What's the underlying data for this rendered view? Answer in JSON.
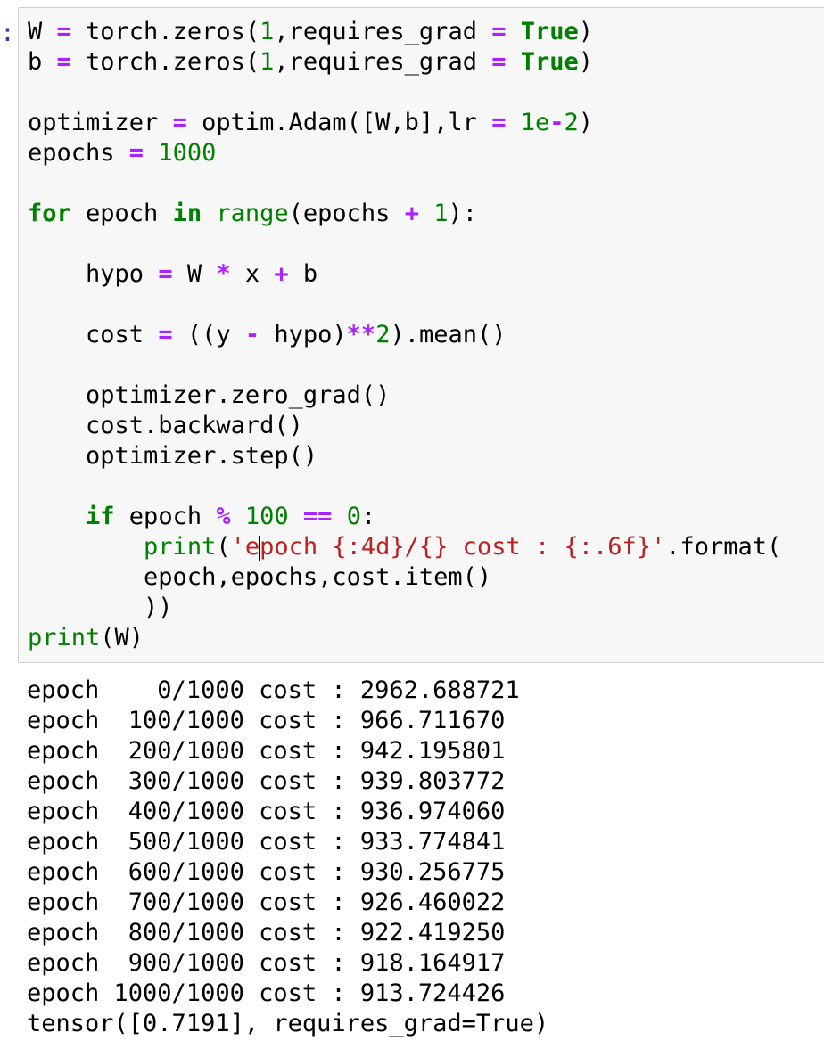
{
  "cell": {
    "prompt_marker": ":"
  },
  "code_lines": [
    [
      [
        "",
        "W "
      ],
      [
        "op",
        "="
      ],
      [
        "",
        " torch.zeros("
      ],
      [
        "num",
        "1"
      ],
      [
        "",
        ",requires_grad "
      ],
      [
        "op",
        "="
      ],
      [
        "",
        " "
      ],
      [
        "kw",
        "True"
      ],
      [
        "",
        ")"
      ]
    ],
    [
      [
        "",
        "b "
      ],
      [
        "op",
        "="
      ],
      [
        "",
        " torch.zeros("
      ],
      [
        "num",
        "1"
      ],
      [
        "",
        ",requires_grad "
      ],
      [
        "op",
        "="
      ],
      [
        "",
        " "
      ],
      [
        "kw",
        "True"
      ],
      [
        "",
        ")"
      ]
    ],
    [],
    [
      [
        "",
        "optimizer "
      ],
      [
        "op",
        "="
      ],
      [
        "",
        " optim.Adam([W,b],lr "
      ],
      [
        "op",
        "="
      ],
      [
        "",
        " "
      ],
      [
        "num",
        "1e"
      ],
      [
        "op",
        "-"
      ],
      [
        "num",
        "2"
      ],
      [
        "",
        ")"
      ]
    ],
    [
      [
        "",
        "epochs "
      ],
      [
        "op",
        "="
      ],
      [
        "",
        " "
      ],
      [
        "num",
        "1000"
      ]
    ],
    [],
    [
      [
        "kw",
        "for"
      ],
      [
        "",
        " epoch "
      ],
      [
        "kw",
        "in"
      ],
      [
        "",
        " "
      ],
      [
        "bi",
        "range"
      ],
      [
        "",
        "(epochs "
      ],
      [
        "op",
        "+"
      ],
      [
        "",
        " "
      ],
      [
        "num",
        "1"
      ],
      [
        "",
        "):"
      ]
    ],
    [],
    [
      [
        "",
        "    hypo "
      ],
      [
        "op",
        "="
      ],
      [
        "",
        " W "
      ],
      [
        "op",
        "*"
      ],
      [
        "",
        " x "
      ],
      [
        "op",
        "+"
      ],
      [
        "",
        " b"
      ]
    ],
    [],
    [
      [
        "",
        "    cost "
      ],
      [
        "op",
        "="
      ],
      [
        "",
        " ((y "
      ],
      [
        "op",
        "-"
      ],
      [
        "",
        " hypo)"
      ],
      [
        "op",
        "**"
      ],
      [
        "num",
        "2"
      ],
      [
        "",
        ").mean()"
      ]
    ],
    [],
    [
      [
        "",
        "    optimizer.zero_grad()"
      ]
    ],
    [
      [
        "",
        "    cost.backward()"
      ]
    ],
    [
      [
        "",
        "    optimizer.step()"
      ]
    ],
    [],
    [
      [
        "",
        "    "
      ],
      [
        "kw",
        "if"
      ],
      [
        "",
        " epoch "
      ],
      [
        "op",
        "%"
      ],
      [
        "",
        " "
      ],
      [
        "num",
        "100"
      ],
      [
        "",
        " "
      ],
      [
        "op",
        "=="
      ],
      [
        "",
        " "
      ],
      [
        "num",
        "0"
      ],
      [
        "",
        ":"
      ]
    ],
    [
      [
        "",
        "        "
      ],
      [
        "bi",
        "print"
      ],
      [
        "",
        "("
      ],
      [
        "str",
        "'e"
      ],
      [
        "caret",
        ""
      ],
      [
        "str",
        "poch {:4d}/{} cost : {:.6f}'"
      ],
      [
        "",
        ".format("
      ]
    ],
    [
      [
        "",
        "        epoch,epochs,cost.item()"
      ]
    ],
    [
      [
        "",
        "        ))"
      ]
    ],
    [
      [
        "bi",
        "print"
      ],
      [
        "",
        "(W)"
      ]
    ]
  ],
  "output_lines": [
    "epoch    0/1000 cost : 2962.688721",
    "epoch  100/1000 cost : 966.711670",
    "epoch  200/1000 cost : 942.195801",
    "epoch  300/1000 cost : 939.803772",
    "epoch  400/1000 cost : 936.974060",
    "epoch  500/1000 cost : 933.774841",
    "epoch  600/1000 cost : 930.256775",
    "epoch  700/1000 cost : 926.460022",
    "epoch  800/1000 cost : 922.419250",
    "epoch  900/1000 cost : 918.164917",
    "epoch 1000/1000 cost : 913.724426",
    "tensor([0.7191], requires_grad=True)"
  ]
}
